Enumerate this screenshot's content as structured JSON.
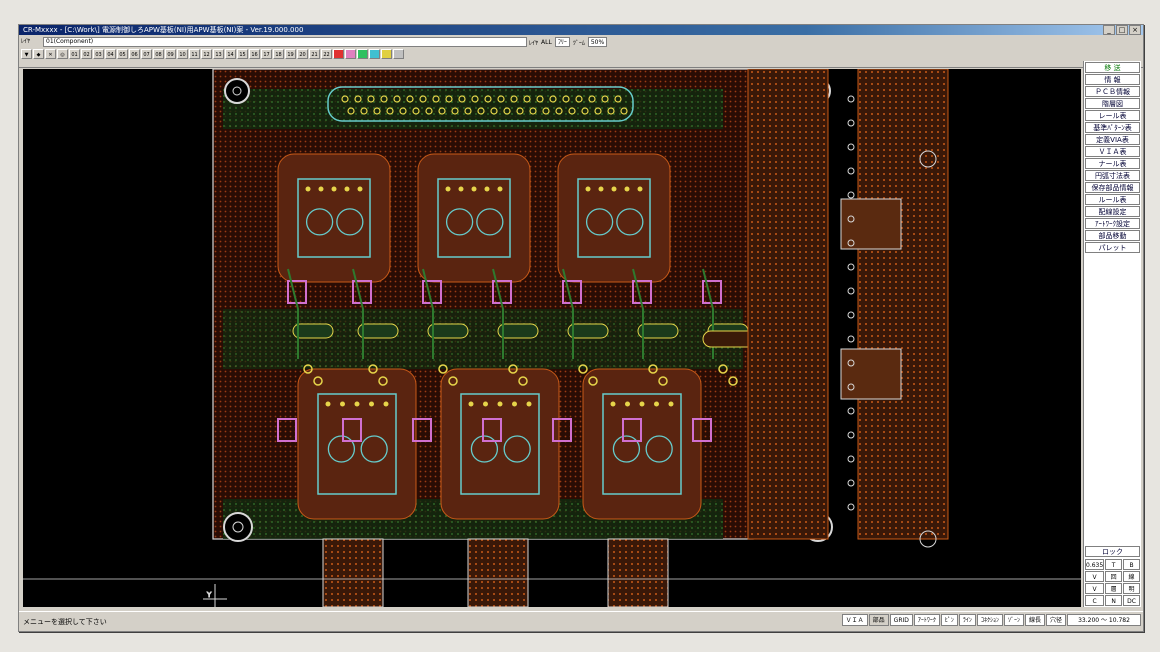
{
  "window": {
    "title": "CR-Mxxxx - [C:\\Work\\] 電源制御しろAPW基板(NI)用APW基板(NI)案 - Ver.19.000.000",
    "layer_selector": "01(Component)",
    "controls": [
      "_",
      "□",
      "×"
    ]
  },
  "toolbar": {
    "menu_label": "ﾚｲﾔ",
    "layer_mode_label": "ﾚｲﾔ",
    "zoom_label": "ﾂﾞｰﾑ",
    "buttons": [
      "▼",
      "◆",
      "✕",
      "◎",
      "01",
      "02",
      "03",
      "04",
      "05",
      "06",
      "07",
      "08",
      "09",
      "10",
      "11",
      "12",
      "13",
      "14",
      "15",
      "16",
      "17",
      "18",
      "19",
      "20",
      "21",
      "22"
    ],
    "tool_label": "ALL",
    "mode_value": "ﾌﾘｰ",
    "zoom_value": "50%"
  },
  "sidebar": {
    "items": [
      "移 送",
      "情 報",
      "ＰＣＢ情報",
      "階層図",
      "レール表",
      "基準ﾊﾟﾀｰﾝ表",
      "定義VIA表",
      "ＶＩＡ表",
      "ナール表",
      "円弧寸法表",
      "保存部品情報",
      "ルール表",
      "配線設定",
      "ｱｰﾄﾜｰｸ設定",
      "部品移動",
      "パレット"
    ],
    "bottom_title": "ロック",
    "bottom_cells": [
      "0.635",
      "T",
      "B",
      "V",
      "回",
      "線",
      "V",
      "層",
      "明",
      "C",
      "N",
      "DC"
    ]
  },
  "status": {
    "message": "メニューを選択して下さい",
    "tabs": [
      "ＶＩＡ",
      "部品",
      "GRID",
      "ｱｰﾄﾜｰｸ",
      "ﾋﾟﾝ",
      "ﾗｲﾝ",
      "ｺﾈｸｼｮﾝ",
      "ｿﾞｰﾝ",
      "線長",
      "穴径"
    ],
    "coordinates": "33.200 ～ 10.782"
  },
  "colors": {
    "board_bg": "#000000",
    "outline": "#d8d8d8",
    "copper_top": "#c85a18",
    "copper_bottom": "#2e7a2e",
    "silk": "#66cccc",
    "pad": "#e6d54a",
    "via": "#d070d0"
  }
}
